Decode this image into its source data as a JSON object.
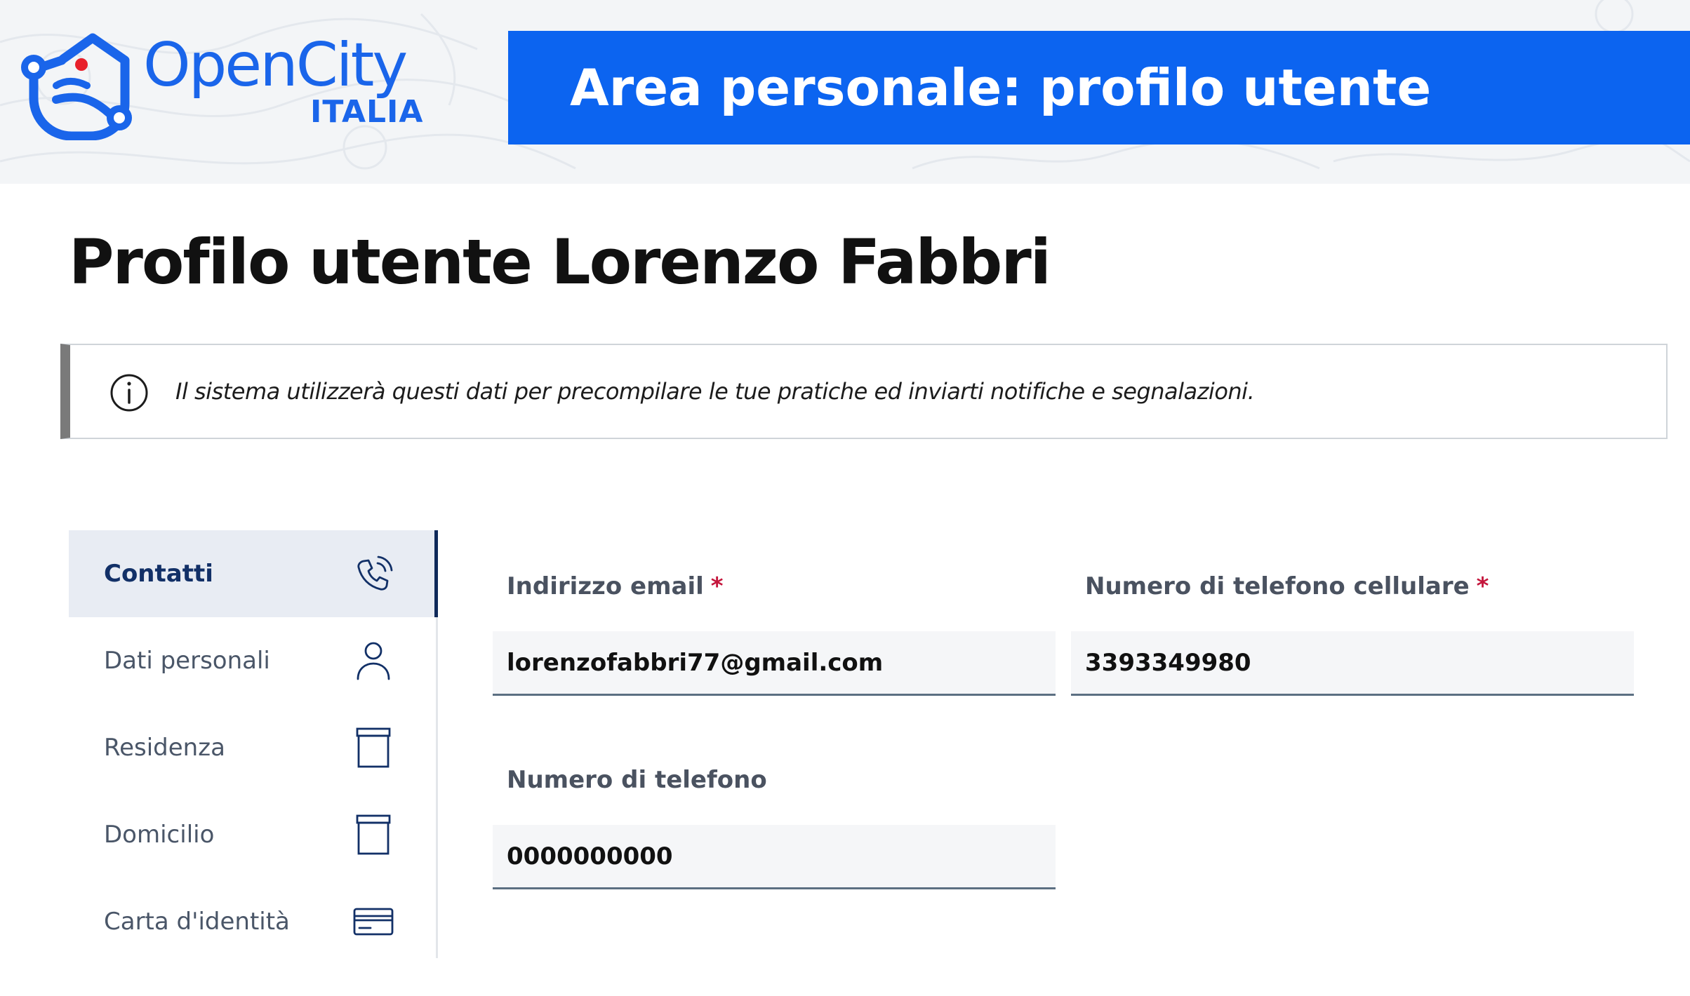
{
  "banner": {
    "logo": {
      "name": "OpenCity",
      "sub": "ITALIA",
      "brand_color": "#1a65ea"
    },
    "title": "Area personale: profilo utente",
    "title_bar_color": "#0c64f0"
  },
  "page": {
    "title": "Profilo utente Lorenzo Fabbri"
  },
  "callout": {
    "icon": "info-icon",
    "text": "Il sistema utilizzerà questi dati per precompilare le tue pratiche ed inviarti notifiche e segnalazioni."
  },
  "sidebar": {
    "items": [
      {
        "label": "Contatti",
        "icon": "phone-icon",
        "active": true
      },
      {
        "label": "Dati personali",
        "icon": "person-icon",
        "active": false
      },
      {
        "label": "Residenza",
        "icon": "archive-box-icon",
        "active": false
      },
      {
        "label": "Domicilio",
        "icon": "archive-box-icon",
        "active": false
      },
      {
        "label": "Carta d'identità",
        "icon": "id-card-icon",
        "active": false
      }
    ]
  },
  "form": {
    "required_mark": "*",
    "email": {
      "label": "Indirizzo email",
      "value": "lorenzofabbri77@gmail.com",
      "required": true
    },
    "mobile": {
      "label": "Numero di telefono cellulare",
      "value": "3393349980",
      "required": true
    },
    "phone": {
      "label": "Numero di telefono",
      "value": "0000000000",
      "required": false
    }
  }
}
